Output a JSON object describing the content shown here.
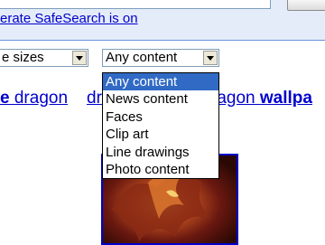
{
  "safesearch_text": "erate SafeSearch is on",
  "filters": {
    "size_value": "e sizes",
    "content_value": "Any content",
    "content_options": [
      "Any content",
      "News content",
      "Faces",
      "Clip art",
      "Line drawings",
      "Photo content"
    ],
    "selected_option": "Any content"
  },
  "related": {
    "item1_bold": "e",
    "item1_text": " dragon",
    "item2_text": "dr",
    "item3_text": "ragon ",
    "item3_bold": "wallpa"
  },
  "colors": {
    "link": "#0000cc",
    "selected": "#316ac5",
    "topbar": "#e5ecf9"
  }
}
